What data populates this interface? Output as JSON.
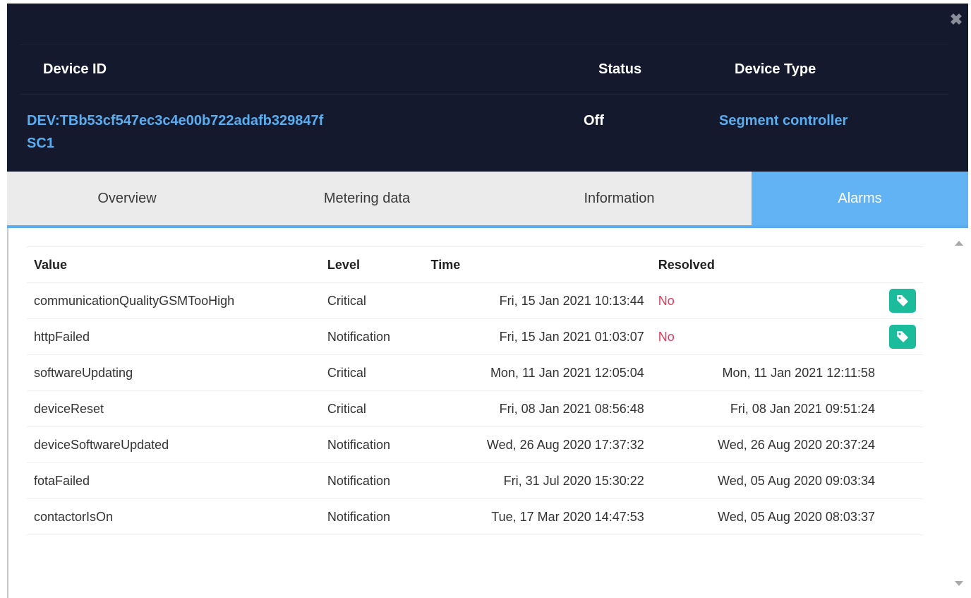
{
  "header": {
    "close_glyph": "✖",
    "labels": {
      "device_id": "Device ID",
      "status": "Status",
      "device_type": "Device Type"
    },
    "device_id": "DEV:TBb53cf547ec3c4e00b722adafb329847f",
    "device_name": "SC1",
    "status": "Off",
    "device_type": "Segment controller",
    "colors": {
      "background": "#14192e",
      "link": "#5aaef0"
    }
  },
  "tabs": [
    {
      "label": "Overview",
      "active": false
    },
    {
      "label": "Metering data",
      "active": false
    },
    {
      "label": "Information",
      "active": false
    },
    {
      "label": "Alarms",
      "active": true
    }
  ],
  "table": {
    "columns": [
      "Value",
      "Level",
      "Time",
      "Resolved"
    ],
    "rows": [
      {
        "value": "communicationQualityGSMTooHigh",
        "level": "Critical",
        "time": "Fri, 15 Jan 2021 10:13:44",
        "resolved": "No",
        "action_icon": "resolve-tag-icon"
      },
      {
        "value": "httpFailed",
        "level": "Notification",
        "time": "Fri, 15 Jan 2021 01:03:07",
        "resolved": "No",
        "action_icon": "resolve-tag-icon"
      },
      {
        "value": "softwareUpdating",
        "level": "Critical",
        "time": "Mon, 11 Jan 2021 12:05:04",
        "resolved": "Mon, 11 Jan 2021 12:11:58"
      },
      {
        "value": "deviceReset",
        "level": "Critical",
        "time": "Fri, 08 Jan 2021 08:56:48",
        "resolved": "Fri, 08 Jan 2021 09:51:24"
      },
      {
        "value": "deviceSoftwareUpdated",
        "level": "Notification",
        "time": "Wed, 26 Aug 2020 17:37:32",
        "resolved": "Wed, 26 Aug 2020 20:37:24"
      },
      {
        "value": "fotaFailed",
        "level": "Notification",
        "time": "Fri, 31 Jul 2020 15:30:22",
        "resolved": "Wed, 05 Aug 2020 09:03:34"
      },
      {
        "value": "contactorIsOn",
        "level": "Notification",
        "time": "Tue, 17 Mar 2020 14:47:53",
        "resolved": "Wed, 05 Aug 2020 08:03:37"
      }
    ]
  },
  "colors": {
    "accent": "#62b3f4",
    "unresolved": "#e8385a",
    "action_button": "#1abc9c"
  }
}
